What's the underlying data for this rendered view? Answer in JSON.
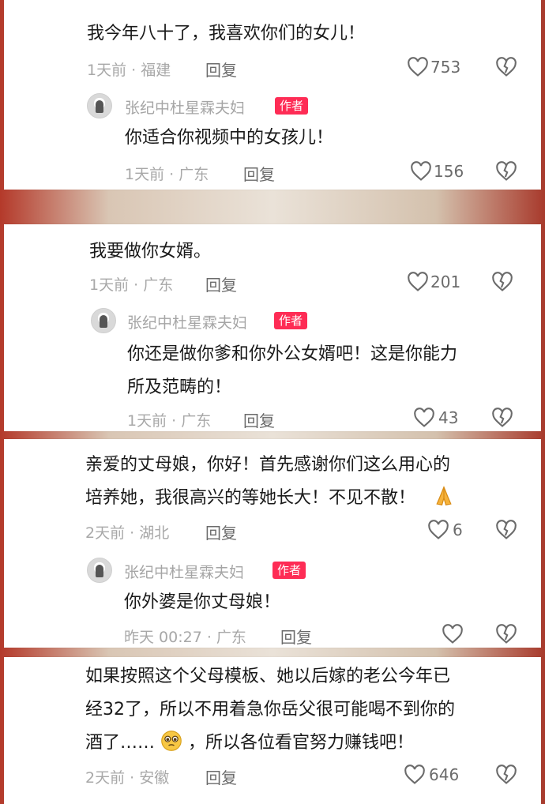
{
  "comments": [
    {
      "text": "我今年八十了，我喜欢你们的女儿！",
      "meta": "1天前 · 福建",
      "reply": "回复",
      "likes": "753",
      "author_reply": {
        "name": "张纪中杜星霖夫妇",
        "badge": "作者",
        "text": "你适合你视频中的女孩儿！",
        "meta": "1天前 · 广东",
        "reply": "回复",
        "likes": "156"
      }
    },
    {
      "text": "我要做你女婿。",
      "meta": "1天前 · 广东",
      "reply": "回复",
      "likes": "201",
      "author_reply": {
        "name": "张纪中杜星霖夫妇",
        "badge": "作者",
        "text_line1": "你还是做你爹和你外公女婿吧！这是你能力",
        "text_line2": "所及范畴的！",
        "meta": "1天前 · 广东",
        "reply": "回复",
        "likes": "43"
      }
    },
    {
      "text_line1": "亲爱的丈母娘，你好！首先感谢你们这么用心的",
      "text_line2": "培养她，我很高兴的等她长大！不见不散！",
      "emoji": "pray-emoji",
      "meta": "2天前 · 湖北",
      "reply": "回复",
      "likes": "6",
      "author_reply": {
        "name": "张纪中杜星霖夫妇",
        "badge": "作者",
        "text": "你外婆是你丈母娘！",
        "meta": "昨天 00:27 · 广东",
        "reply": "回复"
      }
    },
    {
      "text_line1": "如果按照这个父母模板、她以后嫁的老公今年已",
      "text_line2": "经32了，所以不用着急你岳父很可能喝不到你的",
      "text_line3a": "酒了……",
      "emoji": "pleading-face-emoji",
      "text_line3b": "，所以各位看官努力赚钱吧！",
      "meta": "2天前 · 安徽",
      "reply": "回复",
      "likes": "646"
    }
  ],
  "colors": {
    "badge": "#fe2c55",
    "meta": "#a8a8a8",
    "text": "#1a1a1a"
  }
}
